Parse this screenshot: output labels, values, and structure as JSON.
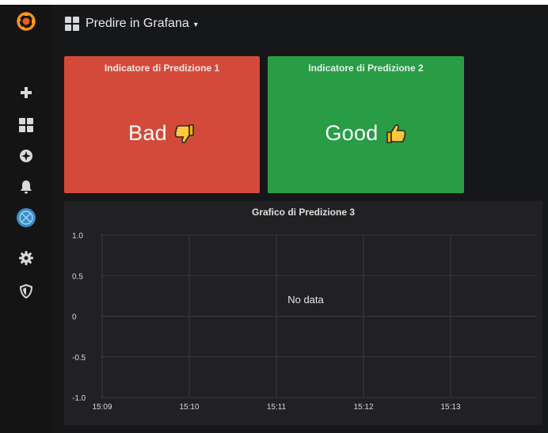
{
  "dashboard": {
    "title": "Predire in Grafana",
    "caret": "▾"
  },
  "sidebar": {
    "items": [
      {
        "icon": "grafana-logo-icon"
      },
      {
        "icon": "plus-icon"
      },
      {
        "icon": "dashboards-grid-icon"
      },
      {
        "icon": "explore-compass-icon"
      },
      {
        "icon": "alerting-bell-icon"
      },
      {
        "icon": "predictive-plugin-icon"
      },
      {
        "icon": "gear-icon"
      },
      {
        "icon": "shield-icon"
      }
    ],
    "accent": "#eb7b18"
  },
  "panels": [
    {
      "title": "Indicatore di Predizione 1",
      "value": "Bad",
      "icon": "thumbs-down-icon",
      "color": "#d44a3a"
    },
    {
      "title": "Indicatore di Predizione 2",
      "value": "Good",
      "icon": "thumbs-up-icon",
      "color": "#299c46"
    }
  ],
  "graph": {
    "title": "Grafico di Predizione 3",
    "no_data": "No data"
  },
  "chart_data": {
    "type": "line",
    "title": "Grafico di Predizione 3",
    "x": [
      "15:09",
      "15:10",
      "15:11",
      "15:12",
      "15:13"
    ],
    "y_ticks": [
      "1.0",
      "0.5",
      "0",
      "-0.5",
      "-1.0"
    ],
    "ylim": [
      -1.0,
      1.0
    ],
    "series": [],
    "grid": true,
    "annotation": "No data"
  }
}
